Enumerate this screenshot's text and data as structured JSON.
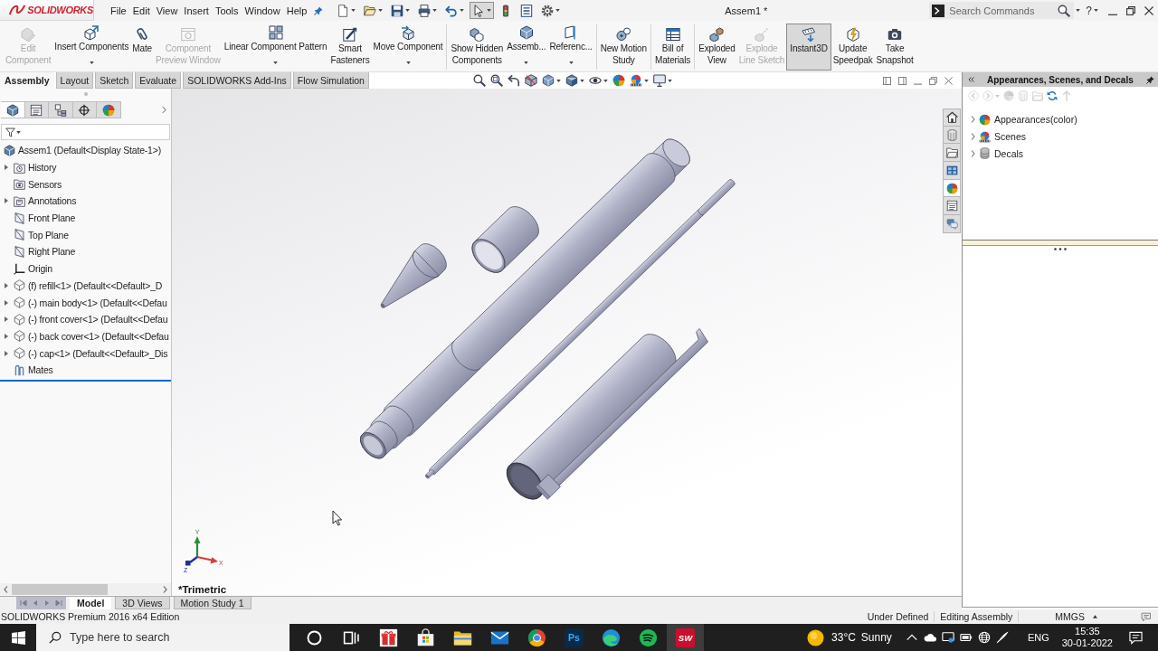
{
  "title_bar": {
    "logo": "SOLIDWORKS",
    "menus": [
      "File",
      "Edit",
      "View",
      "Insert",
      "Tools",
      "Window",
      "Help"
    ],
    "quick_access": [
      {
        "kind": "new",
        "dropdown": true,
        "pressed": false
      },
      {
        "kind": "open",
        "dropdown": true,
        "pressed": false
      },
      {
        "kind": "save",
        "dropdown": true,
        "pressed": false
      },
      {
        "kind": "print",
        "dropdown": true,
        "pressed": false
      },
      {
        "kind": "undo",
        "dropdown": true,
        "pressed": false
      },
      {
        "kind": "select",
        "dropdown": true,
        "pressed": true
      },
      {
        "kind": "rebuild",
        "dropdown": false,
        "pressed": false
      },
      {
        "kind": "file-properties",
        "dropdown": false,
        "pressed": false
      },
      {
        "kind": "options",
        "dropdown": true,
        "pressed": false
      }
    ],
    "document_title": "Assem1 *",
    "search": {
      "placeholder": "Search Commands"
    },
    "help": "?"
  },
  "ribbon": {
    "groups": [
      [
        {
          "kind": "edit-component",
          "label": "Edit\nComponent",
          "disabled": true,
          "dropdown": false,
          "on": false
        },
        {
          "kind": "insert-components",
          "label": "Insert Components",
          "disabled": false,
          "dropdown": true,
          "on": false
        },
        {
          "kind": "mate",
          "label": "Mate",
          "disabled": false,
          "dropdown": false,
          "on": false
        },
        {
          "kind": "component-preview-window",
          "label": "Component\nPreview Window",
          "disabled": true,
          "dropdown": false,
          "on": false
        },
        {
          "kind": "linear-component-pattern",
          "label": "Linear Component Pattern",
          "disabled": false,
          "dropdown": true,
          "on": false
        },
        {
          "kind": "smart-fasteners",
          "label": "Smart\nFasteners",
          "disabled": false,
          "dropdown": false,
          "on": false
        },
        {
          "kind": "move-component",
          "label": "Move Component",
          "disabled": false,
          "dropdown": true,
          "on": false
        }
      ],
      [
        {
          "kind": "show-hidden-components",
          "label": "Show Hidden\nComponents",
          "disabled": false,
          "dropdown": false,
          "on": false
        },
        {
          "kind": "assembly-menu",
          "label": "Assemb...",
          "disabled": false,
          "dropdown": true,
          "on": false
        },
        {
          "kind": "reference-menu",
          "label": "Referenc...",
          "disabled": false,
          "dropdown": true,
          "on": false
        }
      ],
      [
        {
          "kind": "new-motion-study",
          "label": "New Motion\nStudy",
          "disabled": false,
          "dropdown": false,
          "on": false
        }
      ],
      [
        {
          "kind": "bill-of-materials",
          "label": "Bill of\nMaterials",
          "disabled": false,
          "dropdown": false,
          "on": false
        }
      ],
      [
        {
          "kind": "exploded-view",
          "label": "Exploded\nView",
          "disabled": false,
          "dropdown": false,
          "on": false
        },
        {
          "kind": "explode-line-sketch",
          "label": "Explode\nLine Sketch",
          "disabled": true,
          "dropdown": false,
          "on": false
        },
        {
          "kind": "instant3d",
          "label": "Instant3D",
          "disabled": false,
          "dropdown": false,
          "on": true
        },
        {
          "kind": "update-speedpak",
          "label": "Update\nSpeedpak",
          "disabled": false,
          "dropdown": false,
          "on": false
        },
        {
          "kind": "take-snapshot",
          "label": "Take\nSnapshot",
          "disabled": false,
          "dropdown": false,
          "on": false
        }
      ]
    ]
  },
  "command_tabs": [
    {
      "label": "Assembly",
      "selected": true
    },
    {
      "label": "Layout",
      "selected": false
    },
    {
      "label": "Sketch",
      "selected": false
    },
    {
      "label": "Evaluate",
      "selected": false
    },
    {
      "label": "SOLIDWORKS Add-Ins",
      "selected": false
    },
    {
      "label": "Flow Simulation",
      "selected": false
    }
  ],
  "view_toolbar": [
    {
      "kind": "zoom-to-fit",
      "dropdown": false
    },
    {
      "kind": "zoom-to-area",
      "dropdown": false
    },
    {
      "kind": "previous-view",
      "dropdown": false
    },
    {
      "kind": "section-view",
      "dropdown": false
    },
    {
      "kind": "view-orientation",
      "dropdown": true
    },
    {
      "kind": "display-style",
      "dropdown": true
    },
    {
      "kind": "hide-show-items",
      "dropdown": true
    },
    {
      "kind": "edit-appearance",
      "dropdown": false
    },
    {
      "kind": "apply-scene",
      "dropdown": true
    },
    {
      "kind": "view-settings",
      "dropdown": true
    }
  ],
  "feature_manager": {
    "tabs": [
      {
        "kind": "feature-tree",
        "selected": true
      },
      {
        "kind": "property-manager",
        "selected": false
      },
      {
        "kind": "configuration-manager",
        "selected": false
      },
      {
        "kind": "dimxpert-manager",
        "selected": false
      },
      {
        "kind": "display-manager",
        "selected": false
      }
    ],
    "root": "Assem1 (Default<Display State-1>)",
    "items": [
      {
        "kind": "history",
        "label": "History",
        "expandable": true
      },
      {
        "kind": "sensors",
        "label": "Sensors",
        "expandable": false
      },
      {
        "kind": "annotations",
        "label": "Annotations",
        "expandable": true
      },
      {
        "kind": "plane",
        "label": "Front Plane",
        "expandable": false
      },
      {
        "kind": "plane",
        "label": "Top Plane",
        "expandable": false
      },
      {
        "kind": "plane",
        "label": "Right Plane",
        "expandable": false
      },
      {
        "kind": "origin",
        "label": "Origin",
        "expandable": false
      },
      {
        "kind": "part",
        "label": "(f) refill<1> (Default<<Default>_D",
        "expandable": true
      },
      {
        "kind": "part",
        "label": "(-) main body<1> (Default<<Defau",
        "expandable": true
      },
      {
        "kind": "part",
        "label": "(-) front cover<1> (Default<<Defau",
        "expandable": true
      },
      {
        "kind": "part",
        "label": "(-) back cover<1> (Default<<Defau",
        "expandable": true
      },
      {
        "kind": "part",
        "label": "(-) cap<1> (Default<<Default>_Dis",
        "expandable": true
      },
      {
        "kind": "mates",
        "label": "Mates",
        "expandable": false
      }
    ]
  },
  "viewport": {
    "view_name": "*Trimetric",
    "triad": [
      {
        "label": "Y",
        "color": "#2e8b3a"
      },
      {
        "label": "X",
        "color": "#d63c3c"
      },
      {
        "label": "Z",
        "color": "#1f2f9c"
      }
    ]
  },
  "bottom_tabs": [
    {
      "label": "Model",
      "selected": true
    },
    {
      "label": "3D Views",
      "selected": false
    },
    {
      "label": "Motion Study 1",
      "selected": false
    }
  ],
  "task_pane": {
    "title": "Appearances, Scenes, and Decals",
    "tabs": [
      {
        "kind": "home",
        "selected": false
      },
      {
        "kind": "design-library",
        "selected": false
      },
      {
        "kind": "file-explorer",
        "selected": false
      },
      {
        "kind": "view-palette",
        "selected": false
      },
      {
        "kind": "appearances-tab",
        "selected": true
      },
      {
        "kind": "custom-properties",
        "selected": false
      },
      {
        "kind": "forum",
        "selected": false
      }
    ],
    "tools": [
      {
        "kind": "back",
        "disabled": true,
        "dropdown": false
      },
      {
        "kind": "forward",
        "disabled": true,
        "dropdown": true
      },
      {
        "kind": "add-appearance",
        "disabled": true,
        "dropdown": false
      },
      {
        "kind": "library",
        "disabled": true,
        "dropdown": false
      },
      {
        "kind": "folder",
        "disabled": true,
        "dropdown": false
      },
      {
        "kind": "refresh",
        "disabled": false,
        "dropdown": false
      },
      {
        "kind": "up",
        "disabled": true,
        "dropdown": false
      }
    ],
    "items": [
      {
        "kind": "appearances",
        "label": "Appearances(color)",
        "expandable": true
      },
      {
        "kind": "scenes",
        "label": "Scenes",
        "expandable": true
      },
      {
        "kind": "decals",
        "label": "Decals",
        "expandable": true
      }
    ]
  },
  "status_bar": {
    "edition": "SOLIDWORKS Premium 2016 x64 Edition",
    "state": "Under Defined",
    "mode": "Editing Assembly",
    "units": "MMGS"
  },
  "taskbar": {
    "search": {
      "placeholder": "Type here to search"
    },
    "apps": [
      {
        "kind": "cortana",
        "active": false
      },
      {
        "kind": "task-view",
        "active": false
      },
      {
        "kind": "gift",
        "active": false
      },
      {
        "kind": "store",
        "active": false
      },
      {
        "kind": "explorer",
        "active": false
      },
      {
        "kind": "mail",
        "active": false
      },
      {
        "kind": "chrome",
        "active": false
      },
      {
        "kind": "photoshop",
        "text": "Ps",
        "active": false
      },
      {
        "kind": "edge",
        "active": false
      },
      {
        "kind": "spotify",
        "active": false
      },
      {
        "kind": "solidworks",
        "text": "SW",
        "active": true
      }
    ],
    "weather": {
      "temperature": "33°C",
      "condition": "Sunny"
    },
    "language": "ENG",
    "time": "15:35",
    "date": "30-01-2022"
  }
}
